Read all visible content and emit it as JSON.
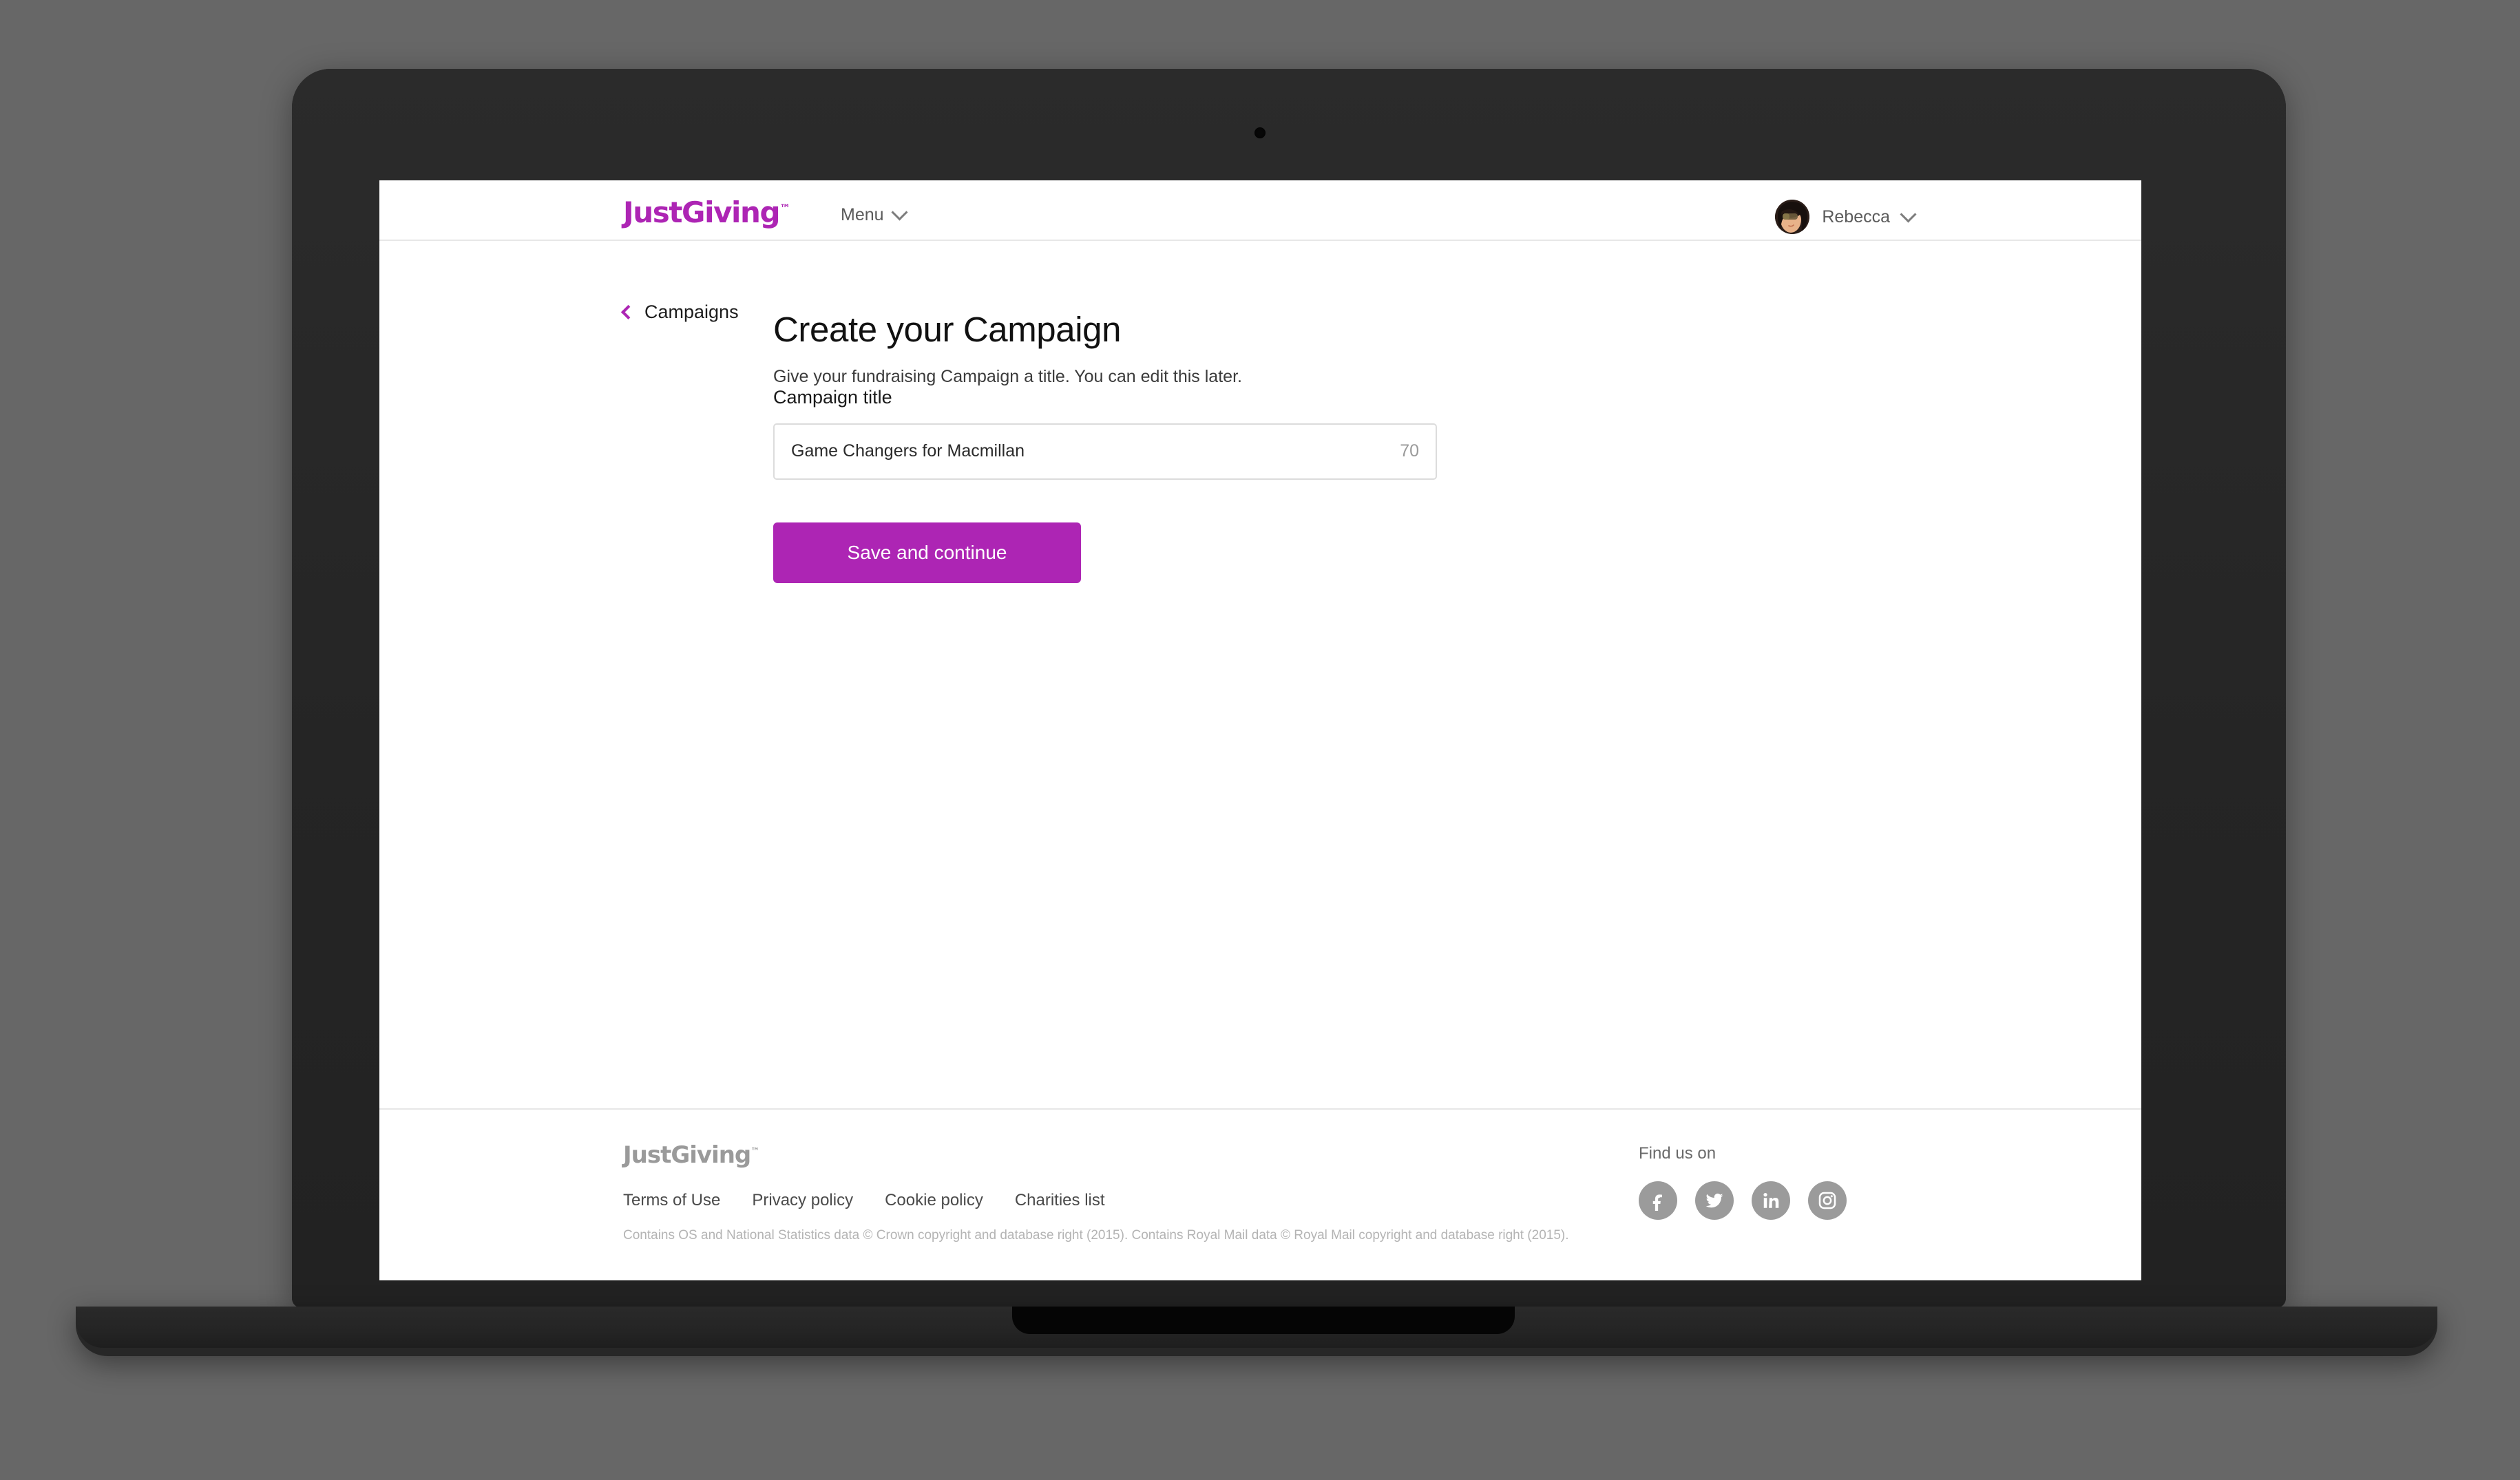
{
  "header": {
    "logo_text": "JustGiving",
    "logo_tm": "™",
    "menu_label": "Menu",
    "menu_chevron_icon": "chevron-down-icon",
    "user_name": "Rebecca",
    "user_chevron_icon": "chevron-down-icon",
    "avatar_icon": "user-avatar"
  },
  "main": {
    "back_link_label": "Campaigns",
    "back_chevron_icon": "chevron-left-icon",
    "title": "Create your Campaign",
    "subtitle": "Give your fundraising Campaign a title. You can edit this later.",
    "field_label": "Campaign title",
    "input_value": "Game Changers for Macmillan",
    "input_placeholder": "Campaign title",
    "char_count": "70",
    "submit_label": "Save and continue"
  },
  "footer": {
    "logo_text": "JustGiving",
    "logo_tm": "™",
    "links": [
      {
        "label": "Terms of Use"
      },
      {
        "label": "Privacy policy"
      },
      {
        "label": "Cookie policy"
      },
      {
        "label": "Charities list"
      }
    ],
    "legal": "Contains OS and National Statistics data © Crown copyright and database right (2015). Contains Royal Mail data © Royal Mail copyright and database right (2015).",
    "find_us_label": "Find us on",
    "social": [
      {
        "name": "facebook-icon"
      },
      {
        "name": "twitter-icon"
      },
      {
        "name": "linkedin-icon"
      },
      {
        "name": "instagram-icon"
      }
    ]
  },
  "colors": {
    "brand_purple": "#AD25B4",
    "page_background": "#676767",
    "device_body": "#272727",
    "social_grey": "#9b9b9b"
  }
}
